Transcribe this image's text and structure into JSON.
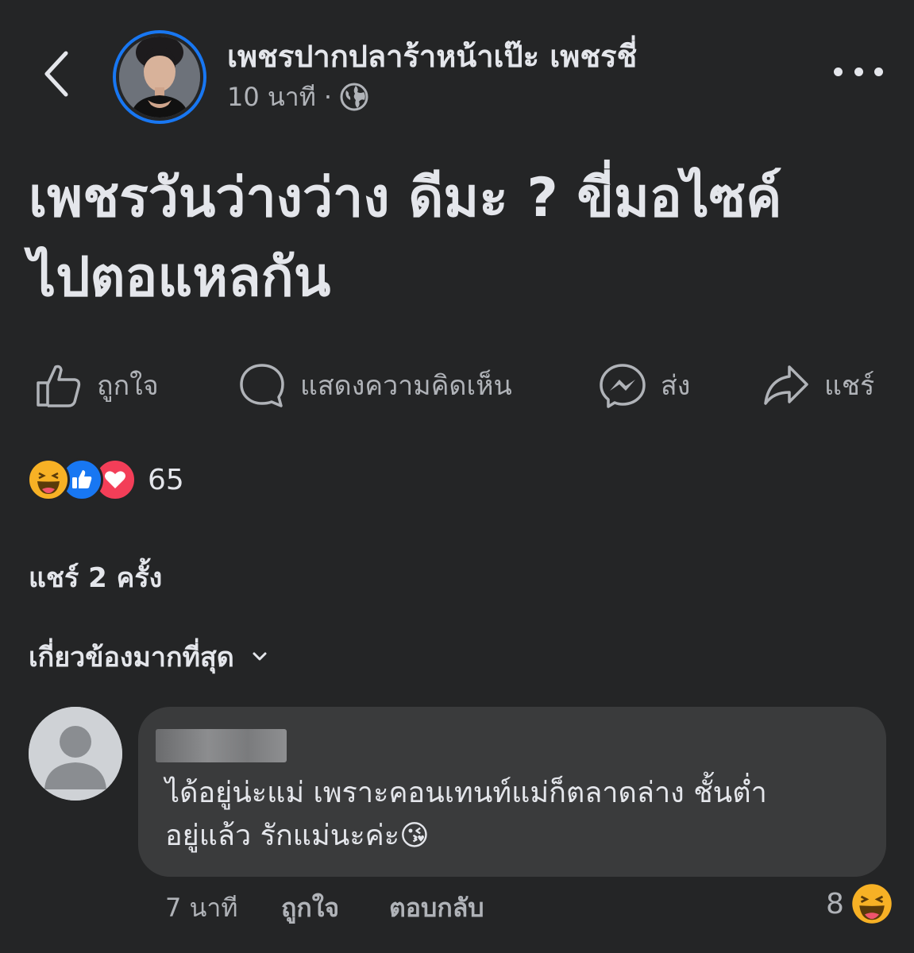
{
  "header": {
    "page_name": "เพชรปากปลาร้าหน้าเป๊ะ เพชรชี่",
    "time": "10 นาที",
    "separator": "·",
    "privacy_icon": "globe-icon",
    "back_icon": "chevron-left-icon",
    "more_icon": "more-horizontal-icon"
  },
  "post": {
    "text_line1": "เพชรวันว่างว่าง ดีมะ ? ขี่มอไซค์",
    "text_line2": "ไปตอแหลกัน"
  },
  "actions": [
    {
      "label": "ถูกใจ",
      "icon": "like-icon"
    },
    {
      "label": "แสดงความคิดเห็น",
      "icon": "comment-icon"
    },
    {
      "label": "ส่ง",
      "icon": "messenger-icon"
    },
    {
      "label": "แชร์",
      "icon": "share-icon"
    }
  ],
  "reactions": {
    "types": [
      "haha",
      "like",
      "love"
    ],
    "count": "65"
  },
  "shares": "แชร์ 2 ครั้ง",
  "sort": {
    "label": "เกี่ยวข้องมากที่สุด",
    "icon": "chevron-down-icon"
  },
  "comment": {
    "text_line1": "ได้อยู่น่ะแม่ เพราะคอนเทนท์แม่ก็ตลาดล่าง ชั้นต่ำ",
    "text_line2": "อยู่แล้ว รักแม่นะค่ะ😘",
    "time": "7 นาที",
    "like_label": "ถูกใจ",
    "reply_label": "ตอบกลับ",
    "reaction_count": "8",
    "reaction_type": "haha"
  },
  "colors": {
    "background": "#242526",
    "bubble": "#3a3b3c",
    "primary_text": "#e4e6eb",
    "secondary_text": "#b0b3b8",
    "accent": "#1877f2",
    "love": "#f33e58",
    "haha": "#f7b125"
  }
}
